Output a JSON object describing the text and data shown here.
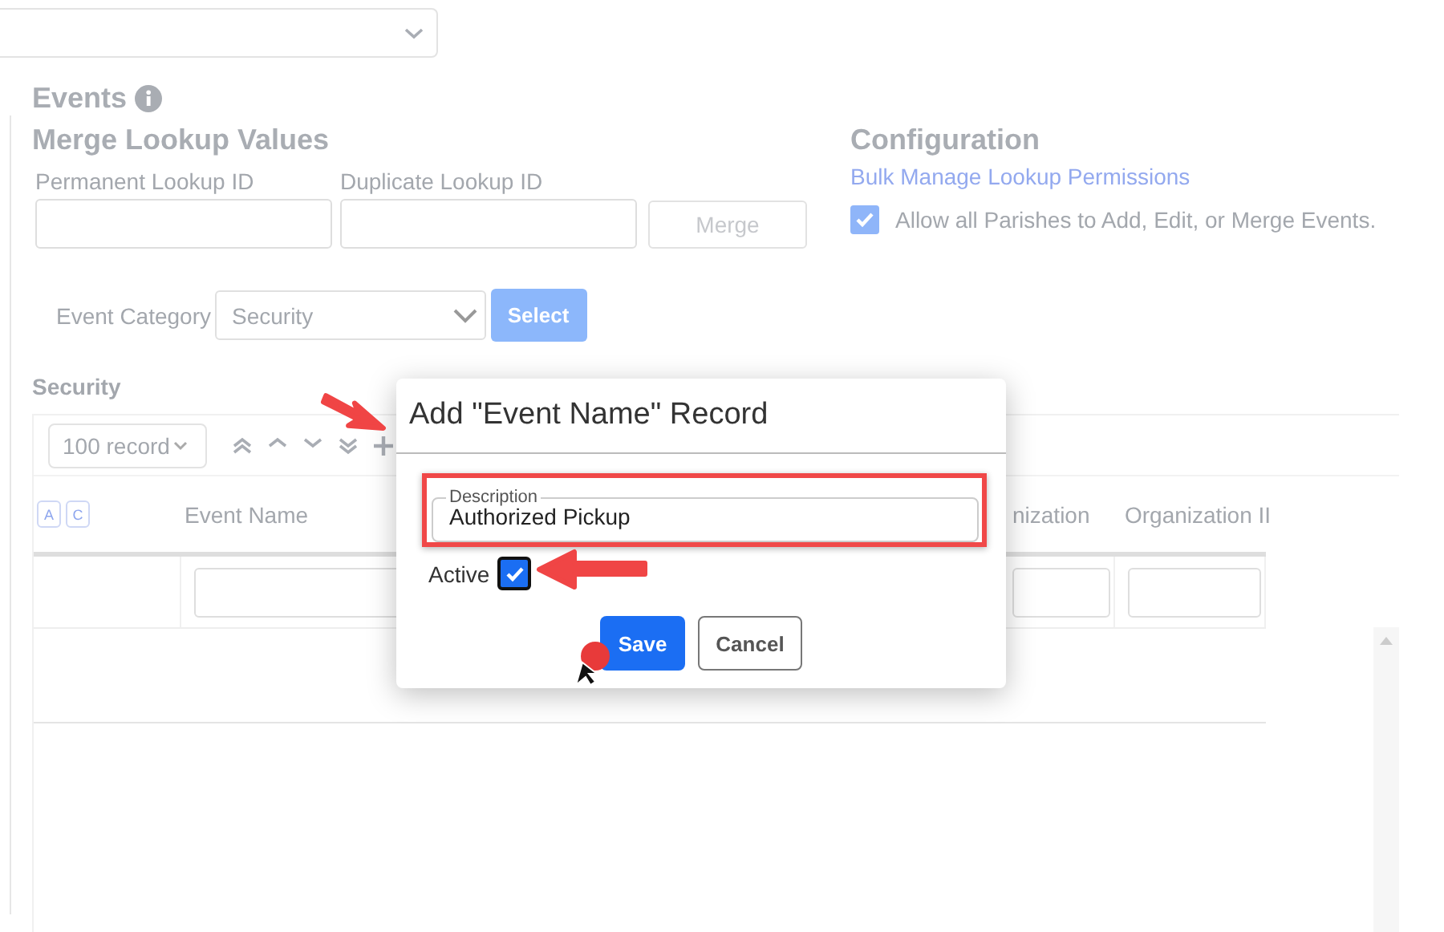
{
  "page_title": "Events",
  "merge": {
    "title": "Merge Lookup Values",
    "fields": [
      {
        "label": "Permanent Lookup ID"
      },
      {
        "label": "Duplicate Lookup ID"
      }
    ],
    "button": {
      "label": "Merge",
      "disabled": true
    }
  },
  "configuration": {
    "title": "Configuration",
    "link": "Bulk Manage Lookup Permissions",
    "option": {
      "label": "Allow all Parishes to Add, Edit, or Merge Events.",
      "checked": true
    }
  },
  "category": {
    "label": "Event Category",
    "value": "Security",
    "button": "Select"
  },
  "table": {
    "title": "Security",
    "page_size": "100 record",
    "sort_badges": [
      "A",
      "C"
    ],
    "columns": [
      "Event Name",
      "nization",
      "Organization II"
    ]
  },
  "dialog": {
    "title": "Add \"Event Name\" Record",
    "field": {
      "label": "Description",
      "value": "Authorized Pickup"
    },
    "active": {
      "label": "Active",
      "checked": true
    },
    "buttons": [
      {
        "label": "Save",
        "kind": "primary"
      },
      {
        "label": "Cancel",
        "kind": "secondary"
      }
    ]
  }
}
